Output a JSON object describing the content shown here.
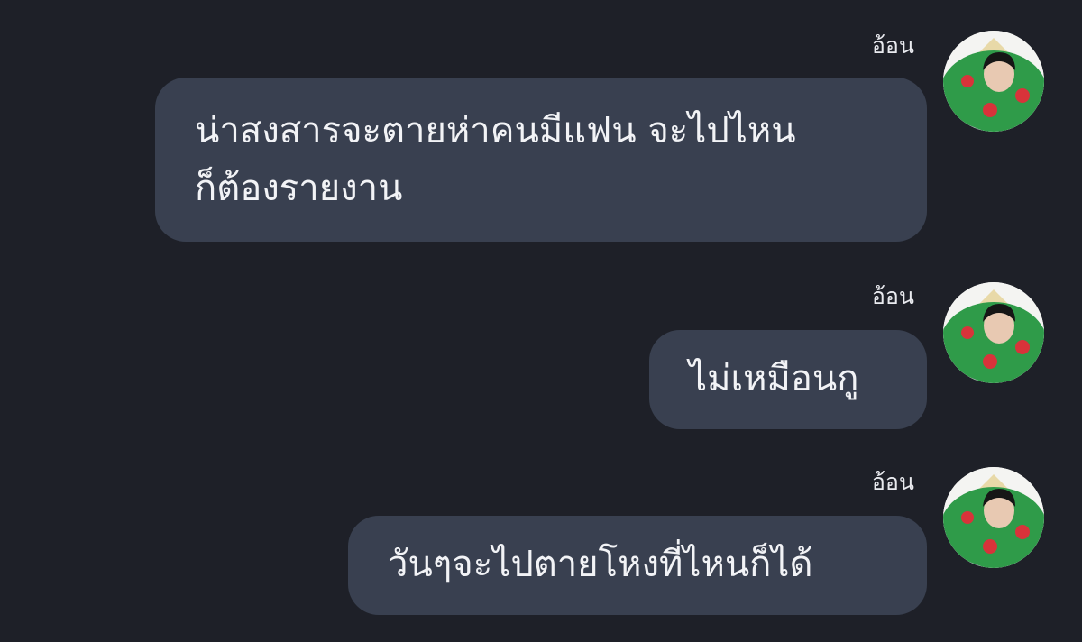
{
  "messages": [
    {
      "sender": "อ้อน",
      "text": "น่าสงสารจะตายห่าคนมีแฟน จะไปไหน\nก็ต้องรายงาน",
      "avatar_icon": "avatar-icon"
    },
    {
      "sender": "อ้อน",
      "text": "ไม่เหมือนกู",
      "avatar_icon": "avatar-icon"
    },
    {
      "sender": "อ้อน",
      "text": "วันๆจะไปตายโหงที่ไหนก็ได้",
      "avatar_icon": "avatar-icon"
    }
  ],
  "colors": {
    "background": "#1e2028",
    "bubble": "#394050",
    "text": "#f2f3f6"
  }
}
